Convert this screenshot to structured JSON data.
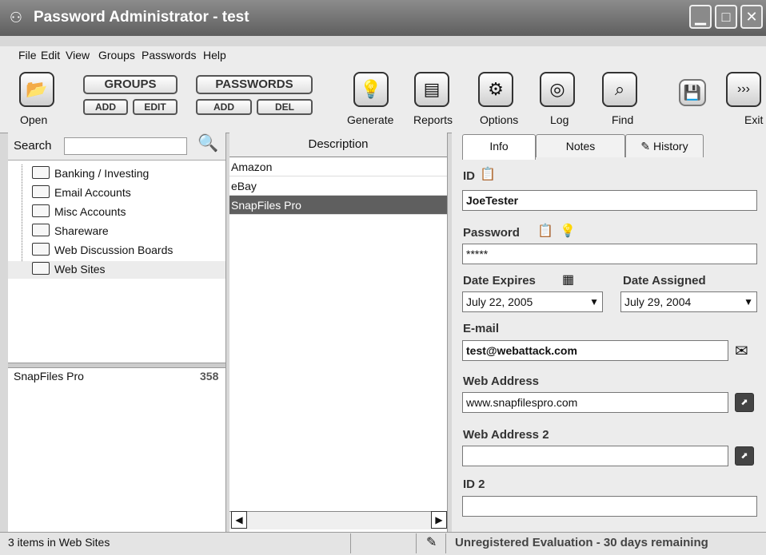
{
  "window": {
    "title": "Password Administrator - test",
    "controls": [
      "minimize",
      "maximize",
      "close"
    ]
  },
  "menu": [
    "File",
    "Edit",
    "View",
    "Groups",
    "Passwords",
    "Help"
  ],
  "toolbar": {
    "open": "Open",
    "groups": "GROUPS",
    "groups_add": "ADD",
    "groups_edit": "EDIT",
    "passwords": "PASSWORDS",
    "passwords_add": "ADD",
    "passwords_del": "DEL",
    "generate": "Generate",
    "reports": "Reports",
    "options": "Options",
    "log": "Log",
    "find": "Find",
    "exit": "Exit"
  },
  "search": {
    "label": "Search",
    "value": ""
  },
  "groups": [
    "Banking / Investing",
    "Email Accounts",
    "Misc Accounts",
    "Shareware",
    "Web Discussion Boards",
    "Web Sites"
  ],
  "selected_group_index": 5,
  "selected_entry": {
    "name": "SnapFiles Pro",
    "count": "358"
  },
  "description_panel": {
    "header": "Description",
    "items": [
      "Amazon",
      "eBay",
      "SnapFiles Pro"
    ],
    "selected_index": 2
  },
  "tabs": [
    "Info",
    "Notes",
    "History"
  ],
  "info": {
    "id_label": "ID",
    "id_value": "JoeTester",
    "password_label": "Password",
    "password_value": "*****",
    "date_expires_label": "Date Expires",
    "date_expires_value": "July 22, 2005",
    "date_assigned_label": "Date Assigned",
    "date_assigned_value": "July 29, 2004",
    "email_label": "E-mail",
    "email_value": "test@webattack.com",
    "web_address_label": "Web Address",
    "web_address_value": "www.snapfilespro.com",
    "web_address_2_label": "Web Address 2",
    "web_address_2_value": "",
    "id2_label": "ID 2",
    "id2_value": ""
  },
  "status": {
    "left": "3 items in Web Sites",
    "right": "Unregistered Evaluation - 30 days remaining"
  }
}
